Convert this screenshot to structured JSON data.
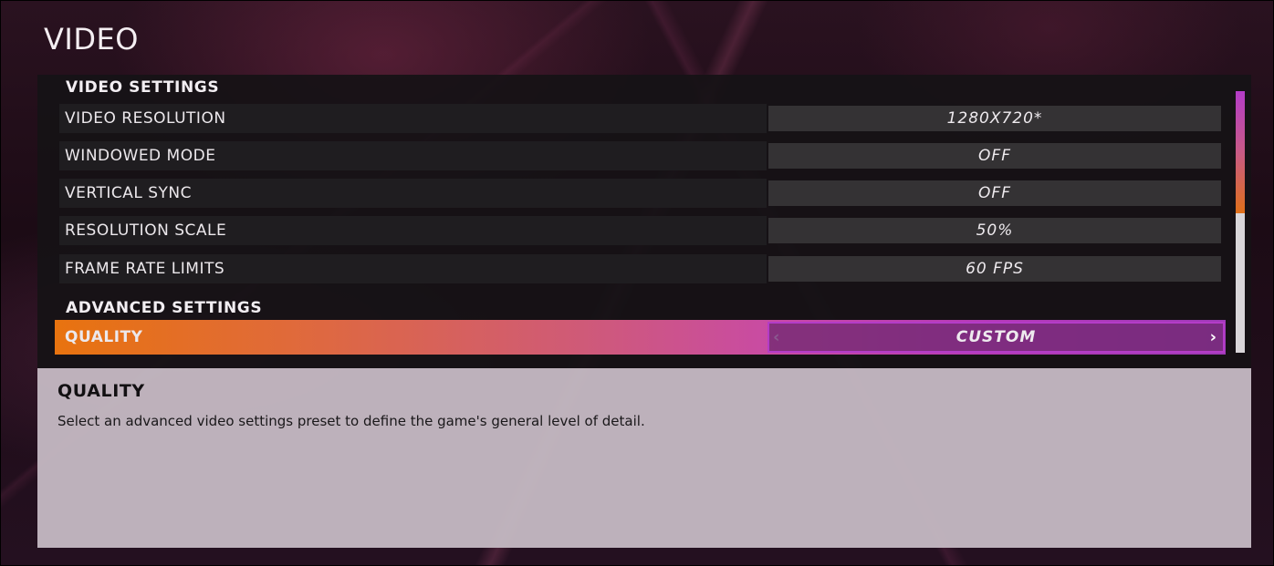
{
  "page": {
    "title": "VIDEO"
  },
  "video_section": {
    "header": "VIDEO SETTINGS",
    "rows": [
      {
        "label": "VIDEO RESOLUTION",
        "value": "1280X720*"
      },
      {
        "label": "WINDOWED MODE",
        "value": "OFF"
      },
      {
        "label": "VERTICAL SYNC",
        "value": "OFF"
      },
      {
        "label": "RESOLUTION SCALE",
        "value": "50%"
      },
      {
        "label": "FRAME RATE LIMITS",
        "value": "60 FPS"
      }
    ]
  },
  "advanced_section": {
    "header": "ADVANCED SETTINGS",
    "selected_row": {
      "label": "QUALITY",
      "value": "CUSTOM",
      "prev_icon": "chevron-left-icon",
      "next_icon": "chevron-right-icon"
    }
  },
  "scrollbar": {
    "position_fraction": 0.0,
    "visible_fraction": 0.47
  },
  "description": {
    "title": "QUALITY",
    "text": "Select an advanced video settings preset to define the game's general level of detail."
  },
  "colors": {
    "accent_orange": "#e8730f",
    "accent_magenta": "#b43cc8",
    "panel_dark": "#1f1d20",
    "value_cell": "#343234",
    "description_bg": "#c4b8c2"
  }
}
